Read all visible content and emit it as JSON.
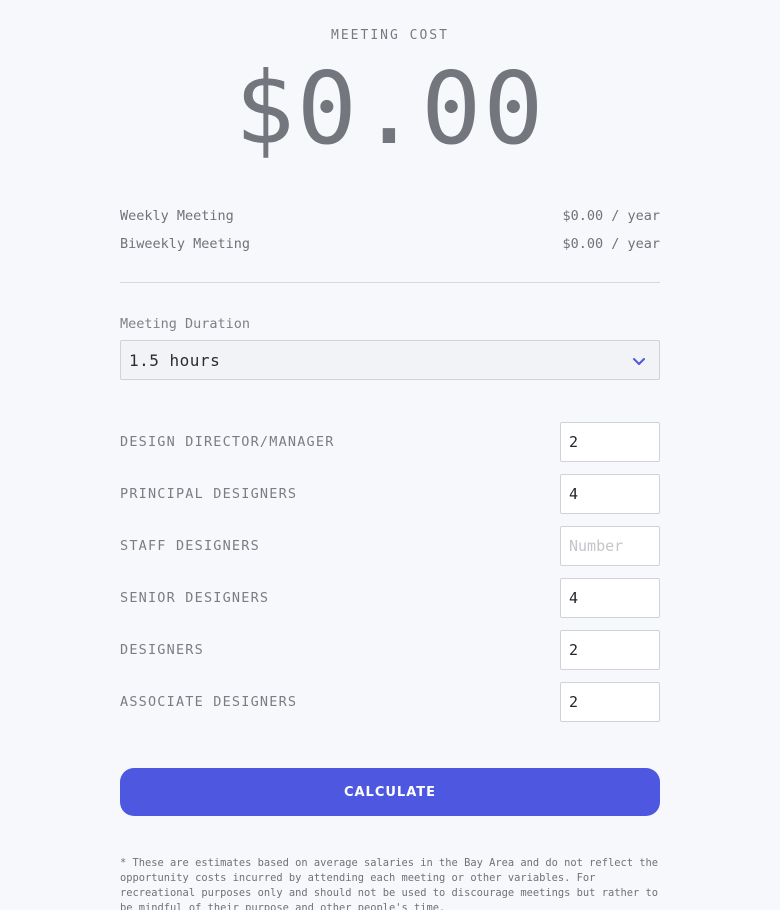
{
  "header": {
    "label": "MEETING COST",
    "total": "$0.00"
  },
  "summary": {
    "rows": [
      {
        "label": "Weekly Meeting",
        "value": "$0.00 / year"
      },
      {
        "label": "Biweekly Meeting",
        "value": "$0.00 / year"
      }
    ]
  },
  "duration": {
    "label": "Meeting Duration",
    "selected": "1.5 hours",
    "icon": "chevron-down-icon"
  },
  "roles": [
    {
      "label": "DESIGN DIRECTOR/MANAGER",
      "value": "2",
      "placeholder": "Number"
    },
    {
      "label": "PRINCIPAL DESIGNERS",
      "value": "4",
      "placeholder": "Number"
    },
    {
      "label": "STAFF DESIGNERS",
      "value": "",
      "placeholder": "Number"
    },
    {
      "label": "SENIOR DESIGNERS",
      "value": "4",
      "placeholder": "Number"
    },
    {
      "label": "DESIGNERS",
      "value": "2",
      "placeholder": "Number"
    },
    {
      "label": "ASSOCIATE DESIGNERS",
      "value": "2",
      "placeholder": "Number"
    }
  ],
  "actions": {
    "calculate_label": "CALCULATE"
  },
  "footnote": {
    "text": "* These are estimates based on average salaries in the Bay Area and do not reflect the opportunity costs incurred by attending each meeting or other variables. For recreational purposes only and should not be used to discourage meetings but rather to be mindful of their purpose and other people's time."
  },
  "colors": {
    "accent": "#4d57e0",
    "background": "#f7f8fb",
    "text": "#6f7278"
  }
}
